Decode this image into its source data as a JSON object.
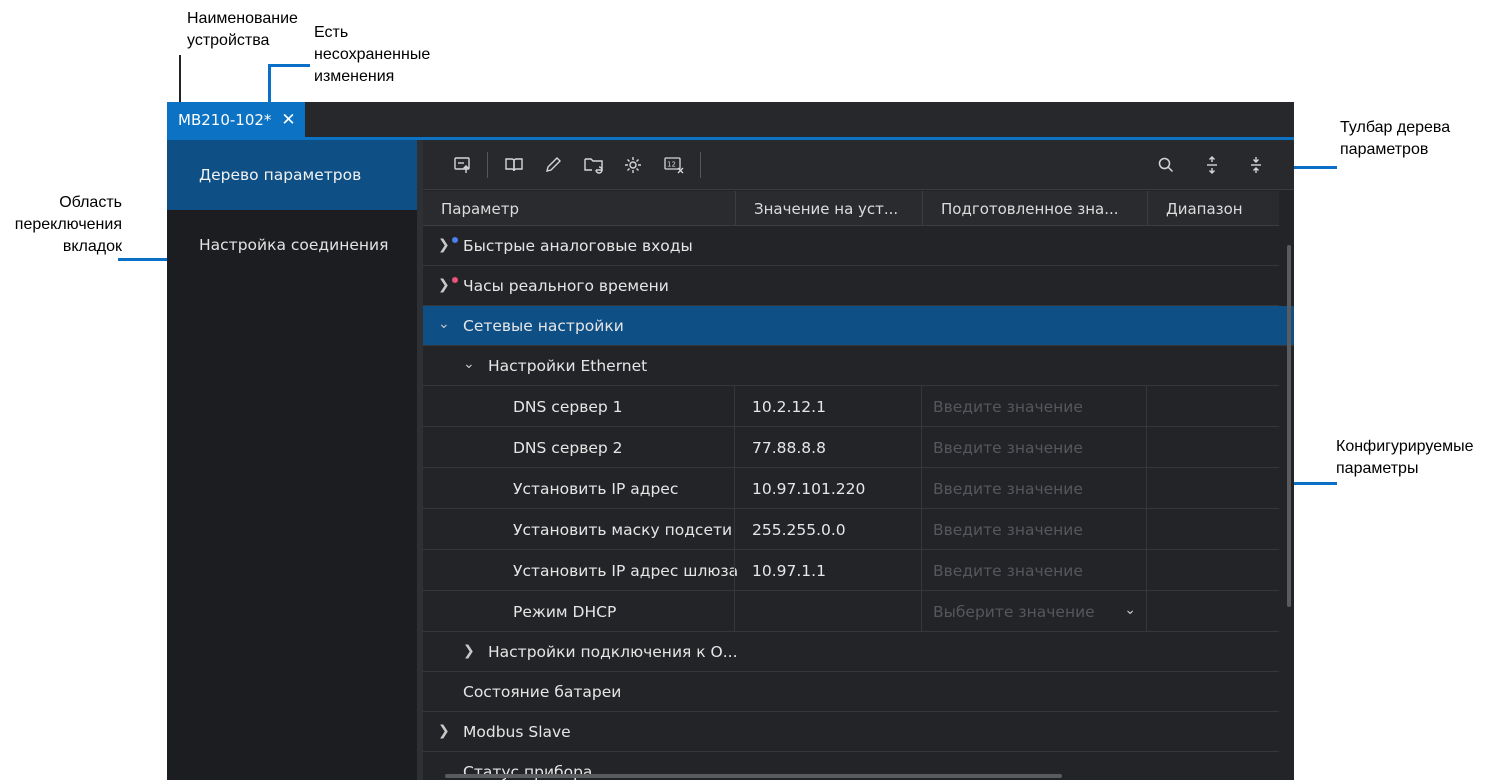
{
  "annotations": {
    "device_name": "Наименование\nустройства",
    "unsaved": "Есть\nнесохраненные\nизменения",
    "tab_area": "Область\nпереключения\nвкладок",
    "toolbar": "Тулбар дерева\nпараметров",
    "configurable": "Конфигурируемые\nпараметры"
  },
  "tab": {
    "title": "МВ210-102*",
    "close_icon": "close-icon"
  },
  "sidebar": {
    "items": [
      {
        "label": "Дерево параметров",
        "active": true
      },
      {
        "label": "Настройка соединения",
        "active": false
      }
    ]
  },
  "toolbar": {
    "icons": [
      "upload-icon",
      "book-icon",
      "pencil-icon",
      "folder-refresh-icon",
      "gear-refresh-icon",
      "clear-values-icon",
      "search-icon",
      "expand-all-icon",
      "collapse-all-icon"
    ]
  },
  "table": {
    "headers": [
      "Параметр",
      "Значение на уст...",
      "Подготовленное зна...",
      "Диапазон"
    ],
    "rows": [
      {
        "name": "Быстрые аналоговые входы",
        "value": "",
        "prepared": "",
        "range": ""
      },
      {
        "name": "Часы реального времени",
        "value": "",
        "prepared": "",
        "range": ""
      },
      {
        "name": "Сетевые настройки",
        "value": "",
        "prepared": "",
        "range": ""
      },
      {
        "name": "Настройки Ethernet",
        "value": "",
        "prepared": "",
        "range": ""
      },
      {
        "name": "DNS сервер 1",
        "value": "10.2.12.1",
        "prepared": "Введите значение",
        "range": ""
      },
      {
        "name": "DNS сервер 2",
        "value": "77.88.8.8",
        "prepared": "Введите значение",
        "range": ""
      },
      {
        "name": "Установить IP адрес",
        "value": "10.97.101.220",
        "prepared": "Введите значение",
        "range": ""
      },
      {
        "name": "Установить маску подсети",
        "value": "255.255.0.0",
        "prepared": "Введите значение",
        "range": ""
      },
      {
        "name": "Установить IP адрес шлюза",
        "value": "10.97.1.1",
        "prepared": "Введите значение",
        "range": ""
      },
      {
        "name": "Режим DHCP",
        "value": "",
        "prepared": "Выберите значение",
        "range": ""
      },
      {
        "name": "Настройки подключения к О...",
        "value": "",
        "prepared": "",
        "range": ""
      },
      {
        "name": "Состояние батареи",
        "value": "",
        "prepared": "",
        "range": ""
      },
      {
        "name": "Modbus Slave",
        "value": "",
        "prepared": "",
        "range": ""
      },
      {
        "name": "Статус прибора",
        "value": "",
        "prepared": "",
        "range": ""
      }
    ]
  },
  "colors": {
    "accent": "#0b72c4",
    "selected_row": "#0e4f86",
    "dot_blue": "#4f7ef0",
    "dot_pink": "#e8547a"
  }
}
